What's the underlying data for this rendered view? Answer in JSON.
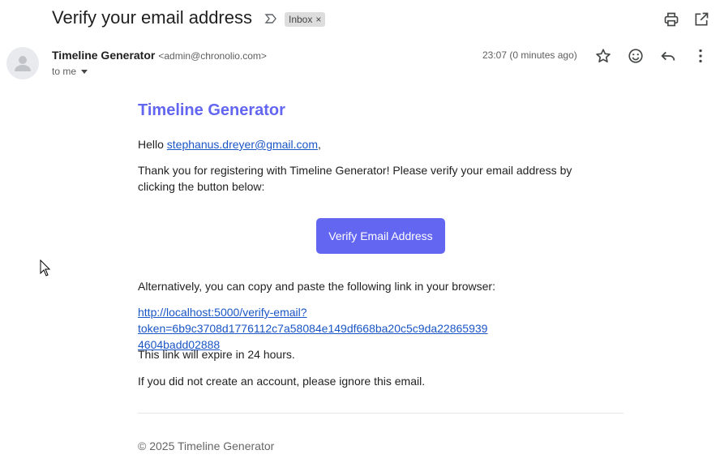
{
  "email": {
    "subject": "Verify your email address",
    "label": "Inbox",
    "label_close": "×",
    "sender_name": "Timeline Generator",
    "sender_email": "<admin@chronolio.com>",
    "to": "to me",
    "time": "23:07 (0 minutes ago)"
  },
  "icons": {
    "important": "important-marker-icon",
    "print": "print-icon",
    "open_new": "open-in-new-window-icon",
    "star": "star-icon",
    "emoji": "emoji-icon",
    "reply": "reply-icon",
    "more": "more-vert-icon"
  },
  "body": {
    "brand": "Timeline Generator",
    "greeting_prefix": "Hello ",
    "greeting_email": "stephanus.dreyer@gmail.com",
    "greeting_suffix": ",",
    "intro": "Thank you for registering with Timeline Generator! Please verify your email address by clicking the button below:",
    "button": "Verify Email Address",
    "alt_text": "Alternatively, you can copy and paste the following link in your browser:",
    "link_line1": "http://localhost:5000/verify-email?token=6b9c3708d1776112c7a58084e149df668ba20c5c9da22865939",
    "link_line2": "4604badd02888",
    "expiry": "This link will expire in 24 hours.",
    "ignore": "If you did not create an account, please ignore this email.",
    "footer": "© 2025 Timeline Generator"
  },
  "colors": {
    "brand": "#6366f1",
    "link": "#1a56c6"
  }
}
